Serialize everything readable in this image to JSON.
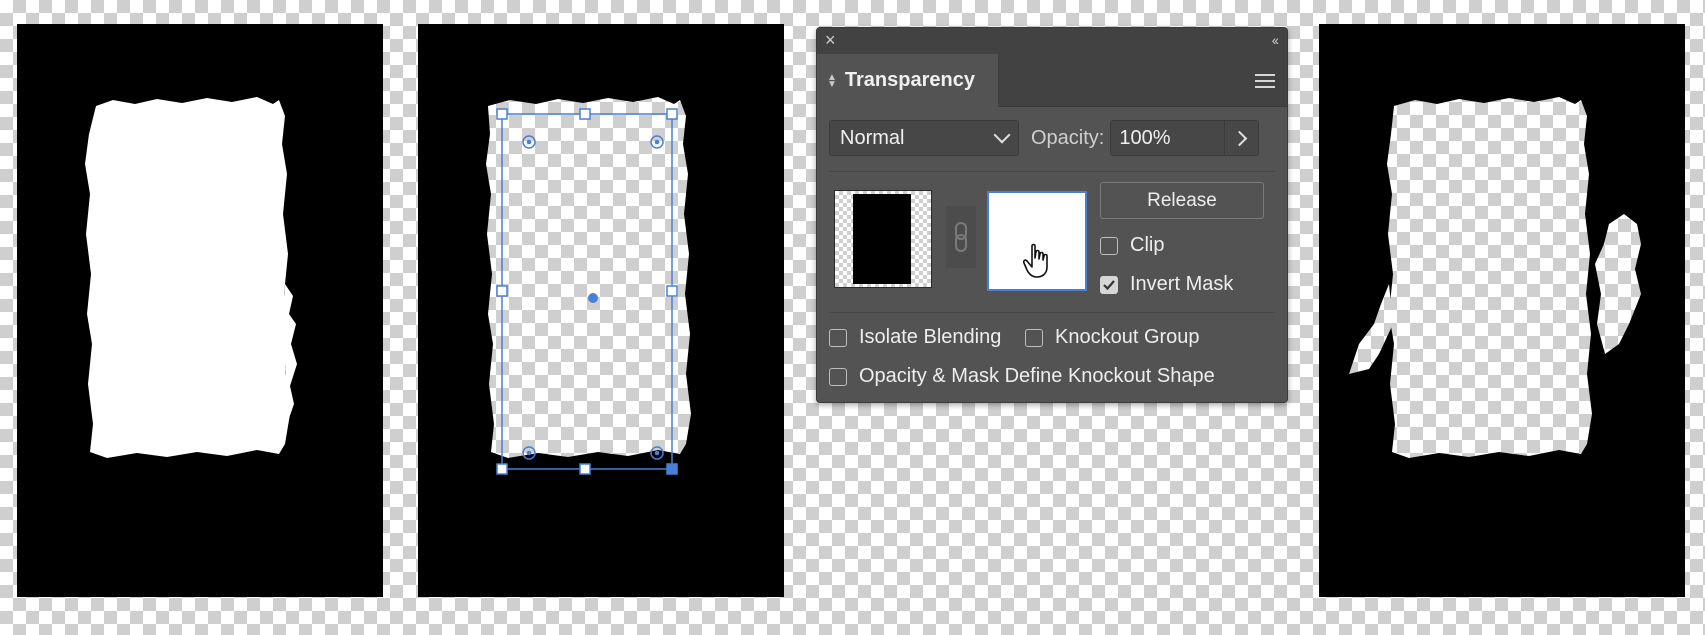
{
  "panel": {
    "close_icon": "×",
    "collapse_icon": "‹‹",
    "tab_title": "Transparency",
    "blend_mode": "Normal",
    "opacity_label": "Opacity:",
    "opacity_value": "100%",
    "release_label": "Release",
    "clip_label": "Clip",
    "clip_checked": false,
    "invert_mask_label": "Invert Mask",
    "invert_mask_checked": true,
    "isolate_blending_label": "Isolate Blending",
    "isolate_blending_checked": false,
    "knockout_group_label": "Knockout Group",
    "knockout_group_checked": false,
    "opacity_mask_define_label": "Opacity & Mask Define Knockout Shape",
    "opacity_mask_define_checked": false
  },
  "icons": {
    "close": "close-icon",
    "collapse": "double-chevron-left-icon",
    "panel_menu": "hamburger-menu-icon",
    "blend_dropdown": "chevron-down-icon",
    "opacity_popup": "chevron-right-icon",
    "link": "chain-link-icon",
    "cursor": "hand-pointer-icon"
  },
  "colors": {
    "panel_bg": "#535353",
    "selection_blue": "#4a7fd6"
  }
}
